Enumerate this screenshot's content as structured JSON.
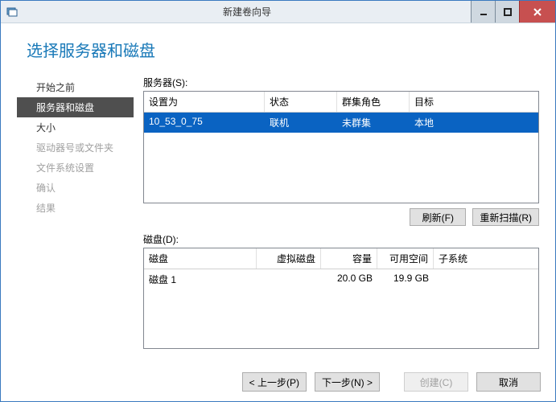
{
  "window": {
    "title": "新建卷向导"
  },
  "page_title": "选择服务器和磁盘",
  "nav": {
    "items": [
      {
        "label": "开始之前",
        "state": "normal"
      },
      {
        "label": "服务器和磁盘",
        "state": "active"
      },
      {
        "label": "大小",
        "state": "normal"
      },
      {
        "label": "驱动器号或文件夹",
        "state": "disabled"
      },
      {
        "label": "文件系统设置",
        "state": "disabled"
      },
      {
        "label": "确认",
        "state": "disabled"
      },
      {
        "label": "结果",
        "state": "disabled"
      }
    ]
  },
  "servers": {
    "label": "服务器(S):",
    "headers": {
      "c1": "设置为",
      "c2": "状态",
      "c3": "群集角色",
      "c4": "目标"
    },
    "rows": [
      {
        "c1": "10_53_0_75",
        "c2": "联机",
        "c3": "未群集",
        "c4": "本地",
        "selected": true
      }
    ],
    "buttons": {
      "refresh": "刷新(F)",
      "rescan": "重新扫描(R)"
    }
  },
  "disks": {
    "label": "磁盘(D):",
    "headers": {
      "d1": "磁盘",
      "d2": "虚拟磁盘",
      "d3": "容量",
      "d4": "可用空间",
      "d5": "子系统"
    },
    "rows": [
      {
        "d1": "磁盘 1",
        "d2": "",
        "d3": "20.0 GB",
        "d4": "19.9 GB",
        "d5": ""
      }
    ]
  },
  "footer": {
    "prev": "< 上一步(P)",
    "next": "下一步(N) >",
    "create": "创建(C)",
    "cancel": "取消"
  }
}
